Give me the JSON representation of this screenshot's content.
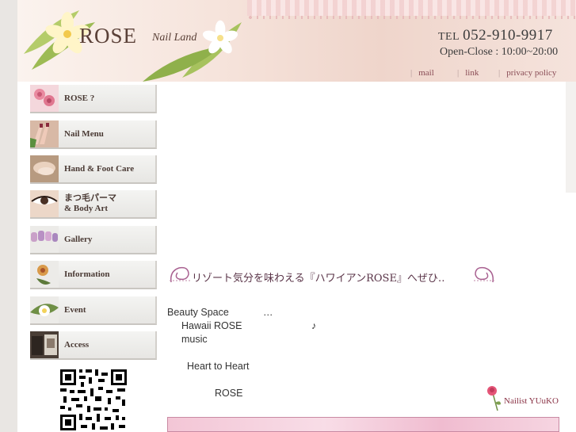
{
  "header": {
    "logo_main": "ROSE",
    "logo_sub": "Nail Land",
    "tel_label": "TEL",
    "tel_number": "052-910-9917",
    "hours": "Open-Close : 10:00~20:00"
  },
  "topnav": [
    {
      "label": "mail"
    },
    {
      "label": "link"
    },
    {
      "label": "privacy policy"
    }
  ],
  "sidebar": {
    "items": [
      {
        "label": "ROSE ?",
        "icon": "rose-flower-icon"
      },
      {
        "label": "Nail Menu",
        "icon": "nail-hand-icon"
      },
      {
        "label": "Hand & Foot Care",
        "icon": "hand-care-icon"
      },
      {
        "label_line1": "まつ毛パーマ",
        "label_line2": "& Body Art",
        "icon": "eye-lash-icon"
      },
      {
        "label": "Gallery",
        "icon": "gallery-nails-icon"
      },
      {
        "label": "Information",
        "icon": "flower-info-icon"
      },
      {
        "label": "Event",
        "icon": "event-flower-icon"
      },
      {
        "label": "Access",
        "icon": "access-storefront-icon"
      }
    ]
  },
  "content": {
    "heading": "リゾート気分を味わえる『ハワイアンROSE』へぜひ‥",
    "lines": [
      {
        "text": "Beauty Space"
      },
      {
        "text": "…"
      },
      {
        "text": "Hawaii ROSE"
      },
      {
        "text": "♪"
      },
      {
        "text": "music"
      },
      {
        "text": "Heart to Heart"
      },
      {
        "text": "ROSE"
      }
    ],
    "nailist": "Nailist YUuKO"
  },
  "colors": {
    "accent": "#8a3346",
    "menu_bg": "#ecebe8",
    "header_bg": "#f6e4dc",
    "heading_text": "#5a3448"
  }
}
